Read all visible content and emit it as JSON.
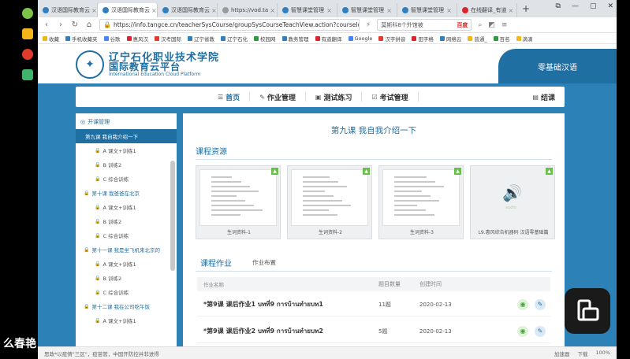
{
  "browser": {
    "tabs": [
      {
        "label": "汉语国际教育云",
        "color": "#2f7fc1",
        "active": false
      },
      {
        "label": "汉语国际教育云",
        "color": "#2f7fc1",
        "active": true
      },
      {
        "label": "汉语国际教育云",
        "color": "#2f7fc1",
        "active": false
      },
      {
        "label": "https://vod.ta",
        "color": "#9a9a9a",
        "active": false
      },
      {
        "label": "智慧课堂管理",
        "color": "#2f7fc1",
        "active": false
      },
      {
        "label": "智慧课堂管理",
        "color": "#2f7fc1",
        "active": false
      },
      {
        "label": "智慧课堂管理",
        "color": "#2f7fc1",
        "active": false
      },
      {
        "label": "在线翻译_有道",
        "color": "#d9262c",
        "active": false
      }
    ],
    "new_tab": "+",
    "window_controls": [
      "⧉",
      "—",
      "▢",
      "✕"
    ],
    "url": "https://info.tangce.cn/teacherSysCourse/groupSysCourseTeachView.action?courseId=&tea",
    "search_text": "莫斯科8个外馆被",
    "search_brand": "百度",
    "bookmarks": [
      "收藏",
      "手机收藏夹",
      "谷歌",
      "惠风汉",
      "汉考国际",
      "辽宁省教",
      "辽宁石化",
      "校园网",
      "教务管理",
      "有道翻译",
      "Google",
      "汉字拼音",
      "田字格",
      "网络云",
      "普通_",
      "百名",
      "滴滴"
    ]
  },
  "site": {
    "logo_glyph": "✦",
    "name_line1": "辽宁石化职业技术学院",
    "name_line2": "国际教育云平台",
    "name_line3": "International Education Cloud Platform",
    "zero_base": "零基础汉语"
  },
  "nav": {
    "items": [
      {
        "label": "首页",
        "icon": "☰",
        "active": true
      },
      {
        "label": "作业管理",
        "icon": "✎",
        "active": false
      },
      {
        "label": "测试练习",
        "icon": "▣",
        "active": false
      },
      {
        "label": "考试管理",
        "icon": "☑",
        "active": false
      }
    ],
    "end_label": "结课",
    "end_icon": "▤"
  },
  "sidebar": {
    "header": "开课管理",
    "entries": [
      {
        "kind": "item",
        "label": "第九课 我自我介绍一下",
        "active": true
      },
      {
        "kind": "item",
        "label": "A 课文+训练1"
      },
      {
        "kind": "item",
        "label": "B 训练2"
      },
      {
        "kind": "item",
        "label": "C 综合训练"
      },
      {
        "kind": "lesson",
        "label": "第十课 我爸爸在北京"
      },
      {
        "kind": "item",
        "label": "A 课文+训练1"
      },
      {
        "kind": "item",
        "label": "B 训练2"
      },
      {
        "kind": "item",
        "label": "C 综合训练"
      },
      {
        "kind": "lesson",
        "label": "第十一课 我是坐飞机来北京的"
      },
      {
        "kind": "item",
        "label": "A 课文+训练1"
      },
      {
        "kind": "item",
        "label": "B 训练2"
      },
      {
        "kind": "item",
        "label": "C 综合训练"
      },
      {
        "kind": "lesson",
        "label": "第十二课 我在公司吃午饭"
      },
      {
        "kind": "item",
        "label": "A 课文+训练1"
      }
    ]
  },
  "content": {
    "lesson_title": "第九课 我自我介绍一下",
    "resources_label": "课程资源",
    "resources": [
      {
        "caption": "生词资料-1",
        "type": "doc"
      },
      {
        "caption": "生词资料-2",
        "type": "doc"
      },
      {
        "caption": "生词资料-3",
        "type": "doc"
      },
      {
        "caption": "L9.惠风综合机器码 汉语零基础篇",
        "type": "audio"
      }
    ],
    "audio_label": "audio",
    "assign_tab": "课程作业",
    "assign_tab2": "作业布置",
    "table_headers": [
      "作业名称",
      "题目数量",
      "创建时间",
      ""
    ],
    "rows": [
      {
        "name": "*第9课 课后作业1 บทที่9 การบ้านทำยบท1",
        "count": "11题",
        "date": "2020-02-13"
      },
      {
        "name": "*第9课 课后作业2 บทที่9 การบ้านทำยบท2",
        "count": "5题",
        "date": "2020-02-13"
      }
    ]
  },
  "statusbar": {
    "left": "思政*以疫情\"三区\"，疫苗管，中国开防控并非进得",
    "right": [
      "加速器",
      "下载",
      "100%"
    ]
  },
  "overlay": {
    "watermark": "么春艳"
  }
}
